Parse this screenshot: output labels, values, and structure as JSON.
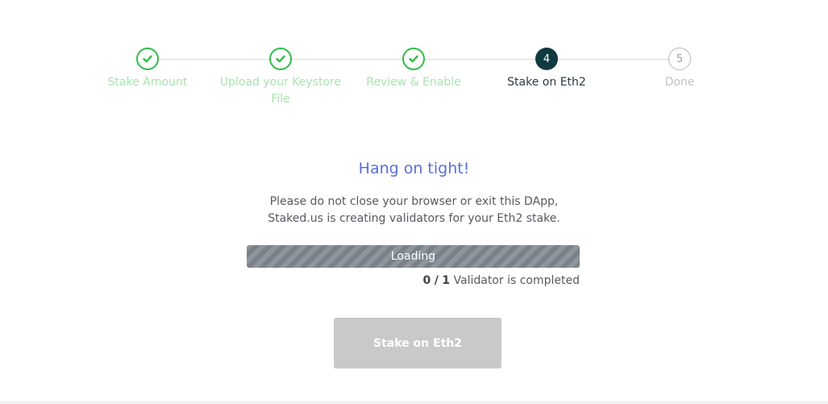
{
  "stepper": {
    "steps": [
      {
        "number": "1",
        "label": "Stake Amount",
        "state": "done"
      },
      {
        "number": "2",
        "label": "Upload your Keystore File",
        "state": "done"
      },
      {
        "number": "3",
        "label": "Review & Enable",
        "state": "done"
      },
      {
        "number": "4",
        "label": "Stake on Eth2",
        "state": "active"
      },
      {
        "number": "5",
        "label": "Done",
        "state": "pending"
      }
    ],
    "done_icon": "checkmark-icon"
  },
  "main": {
    "headline": "Hang on tight!",
    "message_line1": "Please do not close your browser or exit this DApp,",
    "message_line2": "Staked.us is creating validators for your Eth2 stake."
  },
  "progress": {
    "label": "Loading"
  },
  "completion": {
    "done_count": "0",
    "separator": "/",
    "total_count": "1",
    "suffix": "Validator is completed"
  },
  "actions": {
    "stake_button_label": "Stake on Eth2"
  },
  "colors": {
    "done_green": "#2fbd47",
    "active_step": "#0f3a40",
    "headline_blue": "#5a6fd8",
    "button_disabled": "#c9c9c9"
  }
}
